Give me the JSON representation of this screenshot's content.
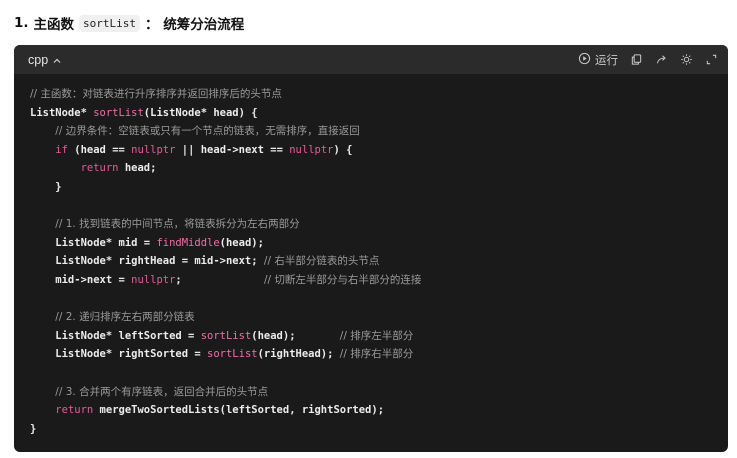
{
  "heading": {
    "number": "1.",
    "title_prefix": "主函数",
    "code_word": "sortList",
    "title_suffix": "：  统筹分治流程"
  },
  "code_card": {
    "language": "cpp",
    "run_label": "运行",
    "icons": [
      "play-circle-icon",
      "copy-icon",
      "share-icon",
      "theme-icon",
      "expand-icon"
    ]
  },
  "code_lines": [
    [
      {
        "t": "cm",
        "v": "// 主函数：对链表进行升序排序并返回排序后的头节点"
      }
    ],
    [
      {
        "t": "pl",
        "v": "ListNode* "
      },
      {
        "t": "fn",
        "v": "sortList"
      },
      {
        "t": "pl",
        "v": "(ListNode* head) {"
      }
    ],
    [
      {
        "t": "pl",
        "v": "    "
      },
      {
        "t": "cm",
        "v": "// 边界条件：空链表或只有一个节点的链表，无需排序，直接返回"
      }
    ],
    [
      {
        "t": "pl",
        "v": "    "
      },
      {
        "t": "kw",
        "v": "if"
      },
      {
        "t": "pl",
        "v": " (head == "
      },
      {
        "t": "kw",
        "v": "nullptr"
      },
      {
        "t": "pl",
        "v": " || head->next == "
      },
      {
        "t": "kw",
        "v": "nullptr"
      },
      {
        "t": "pl",
        "v": ") {"
      }
    ],
    [
      {
        "t": "pl",
        "v": "        "
      },
      {
        "t": "kw",
        "v": "return"
      },
      {
        "t": "pl",
        "v": " head;"
      }
    ],
    [
      {
        "t": "pl",
        "v": "    }"
      }
    ],
    [
      {
        "t": "pl",
        "v": ""
      }
    ],
    [
      {
        "t": "pl",
        "v": "    "
      },
      {
        "t": "cm",
        "v": "// 1. 找到链表的中间节点，将链表拆分为左右两部分"
      }
    ],
    [
      {
        "t": "pl",
        "v": "    ListNode* mid = "
      },
      {
        "t": "fn",
        "v": "findMiddle"
      },
      {
        "t": "pl",
        "v": "(head);"
      }
    ],
    [
      {
        "t": "pl",
        "v": "    ListNode* rightHead = mid->next; "
      },
      {
        "t": "cm",
        "v": "// 右半部分链表的头节点"
      }
    ],
    [
      {
        "t": "pl",
        "v": "    mid->next = "
      },
      {
        "t": "kw",
        "v": "nullptr"
      },
      {
        "t": "pl",
        "v": ";             "
      },
      {
        "t": "cm",
        "v": "// 切断左半部分与右半部分的连接"
      }
    ],
    [
      {
        "t": "pl",
        "v": ""
      }
    ],
    [
      {
        "t": "pl",
        "v": "    "
      },
      {
        "t": "cm",
        "v": "// 2. 递归排序左右两部分链表"
      }
    ],
    [
      {
        "t": "pl",
        "v": "    ListNode* leftSorted = "
      },
      {
        "t": "fn",
        "v": "sortList"
      },
      {
        "t": "pl",
        "v": "(head);       "
      },
      {
        "t": "cm",
        "v": "// 排序左半部分"
      }
    ],
    [
      {
        "t": "pl",
        "v": "    ListNode* rightSorted = "
      },
      {
        "t": "fn",
        "v": "sortList"
      },
      {
        "t": "pl",
        "v": "(rightHead); "
      },
      {
        "t": "cm",
        "v": "// 排序右半部分"
      }
    ],
    [
      {
        "t": "pl",
        "v": ""
      }
    ],
    [
      {
        "t": "pl",
        "v": "    "
      },
      {
        "t": "cm",
        "v": "// 3. 合并两个有序链表，返回合并后的头节点"
      }
    ],
    [
      {
        "t": "pl",
        "v": "    "
      },
      {
        "t": "kw",
        "v": "return"
      },
      {
        "t": "pl",
        "v": " mergeTwoSortedLists(leftSorted, rightSorted);"
      }
    ],
    [
      {
        "t": "pl",
        "v": "}"
      }
    ]
  ]
}
